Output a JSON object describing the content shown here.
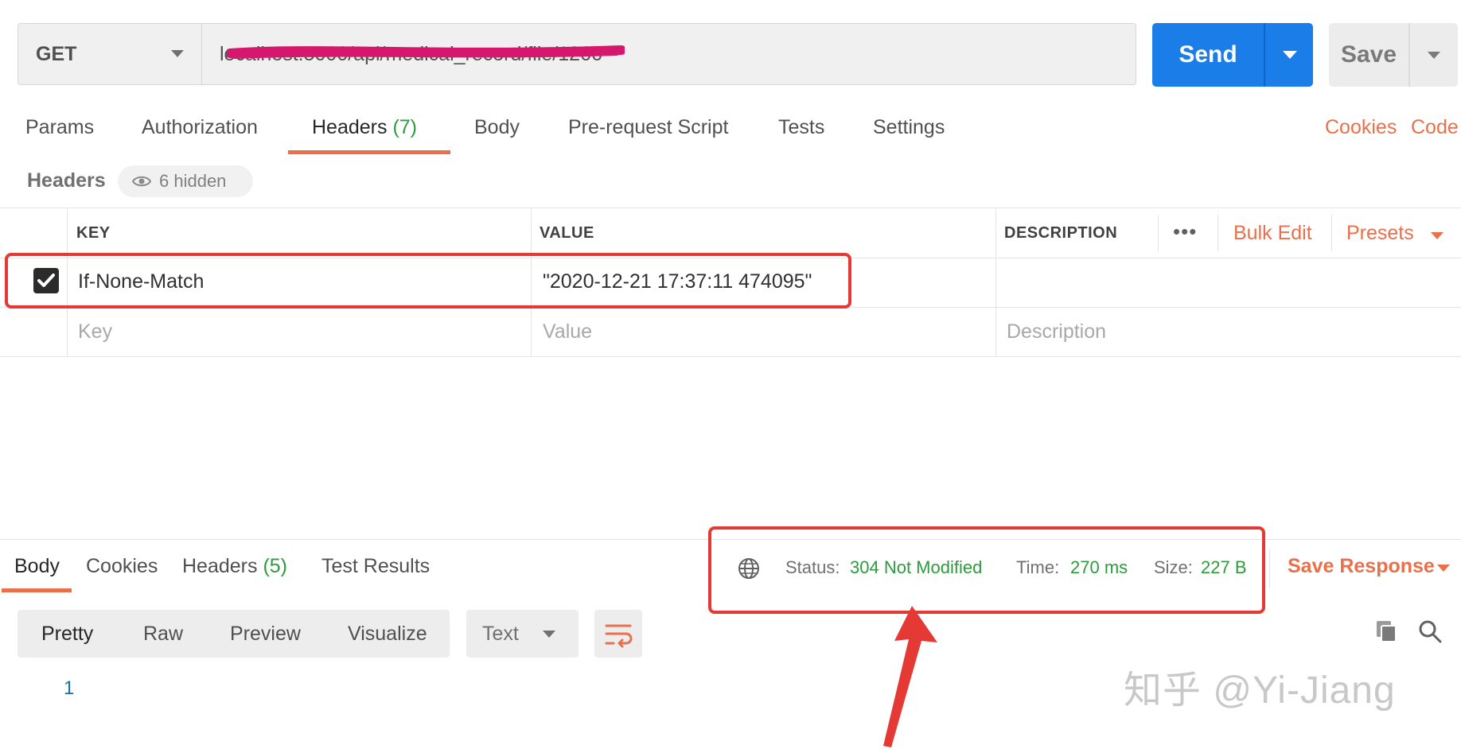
{
  "request": {
    "method": "GET",
    "url": "localhost:5000/api/medical_record/file/1266",
    "send_label": "Send",
    "save_label": "Save"
  },
  "tabs": {
    "params": "Params",
    "authorization": "Authorization",
    "headers": "Headers",
    "headers_count": "(7)",
    "body": "Body",
    "pre_request": "Pre-request Script",
    "tests": "Tests",
    "settings": "Settings",
    "cookies": "Cookies",
    "code": "Code"
  },
  "headers_section": {
    "title": "Headers",
    "hidden": "6 hidden",
    "columns": {
      "key": "KEY",
      "value": "VALUE",
      "description": "DESCRIPTION"
    },
    "more": "•••",
    "bulk_edit": "Bulk Edit",
    "presets": "Presets",
    "rows": [
      {
        "checked": true,
        "key": "If-None-Match",
        "value": "\"2020-12-21 17:37:11 474095\"",
        "description": ""
      }
    ],
    "placeholders": {
      "key": "Key",
      "value": "Value",
      "description": "Description"
    }
  },
  "response": {
    "tabs": {
      "body": "Body",
      "cookies": "Cookies",
      "headers": "Headers",
      "headers_count": "(5)",
      "test_results": "Test Results"
    },
    "status_label": "Status:",
    "status_value": "304 Not Modified",
    "time_label": "Time:",
    "time_value": "270 ms",
    "size_label": "Size:",
    "size_value": "227 B",
    "save_response": "Save Response",
    "view_modes": [
      "Pretty",
      "Raw",
      "Preview",
      "Visualize"
    ],
    "format": "Text",
    "line_number": "1"
  },
  "watermark": "知乎 @Yi-Jiang",
  "colors": {
    "accent_orange": "#e9704a",
    "send_blue": "#1a7de8",
    "status_green": "#2d9a3d",
    "annotation_red": "#e53935",
    "scribble_magenta": "#d6176e"
  }
}
